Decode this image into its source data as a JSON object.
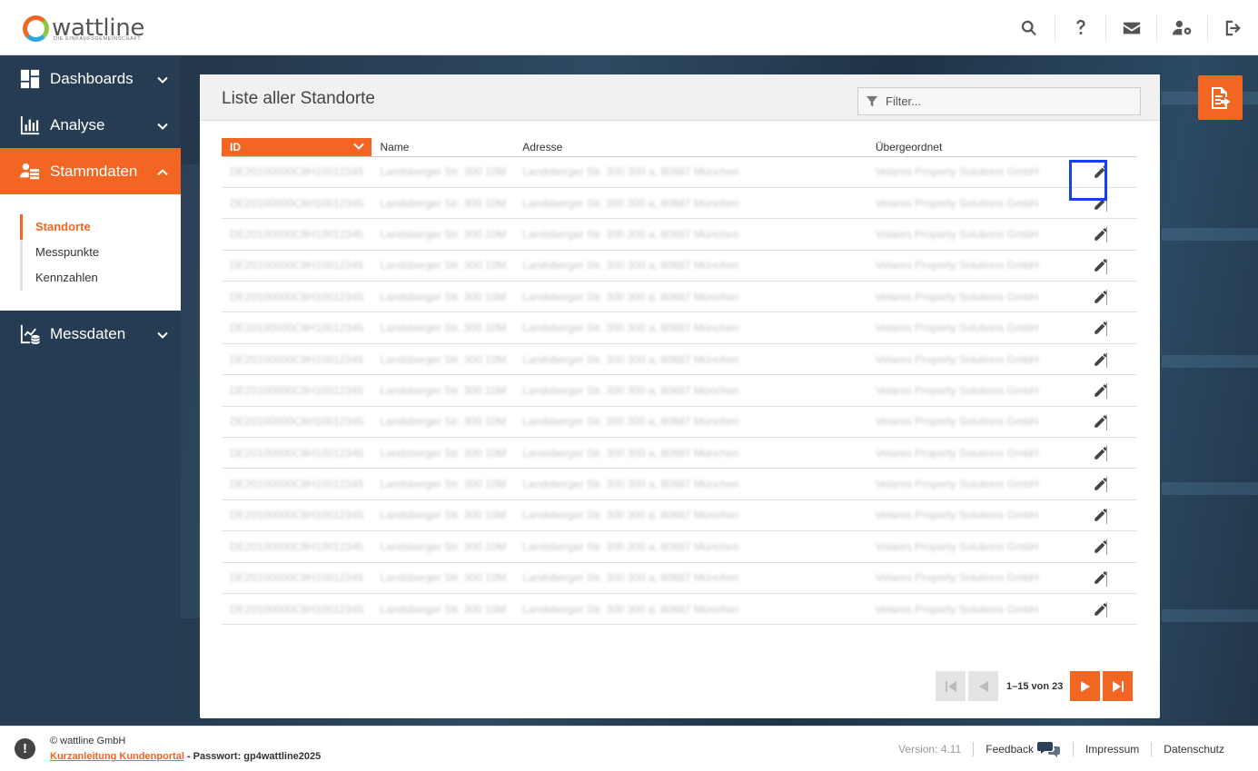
{
  "brand": {
    "name": "wattline",
    "tagline": "DIE EINKAUFSGEMEINSCHAFT"
  },
  "header": {
    "icons": [
      "search-icon",
      "help-icon",
      "mail-icon",
      "user-settings-icon",
      "logout-icon"
    ]
  },
  "sidebar": {
    "items": [
      {
        "label": "Dashboards",
        "icon": "dashboard-icon",
        "active": false
      },
      {
        "label": "Analyse",
        "icon": "bar-chart-icon",
        "active": false
      },
      {
        "label": "Stammdaten",
        "icon": "master-data-icon",
        "active": true
      },
      {
        "label": "Messdaten",
        "icon": "measurement-icon",
        "active": false
      }
    ],
    "subitems": [
      {
        "label": "Standorte",
        "active": true
      },
      {
        "label": "Messpunkte",
        "active": false
      },
      {
        "label": "Kennzahlen",
        "active": false
      }
    ]
  },
  "panel": {
    "title": "Liste aller Standorte",
    "filter_placeholder": "Filter...",
    "columns": [
      "ID",
      "Name",
      "Adresse",
      "Übergeordnet"
    ],
    "rows": [
      [
        "DE20100000C8H10012345",
        "Landsberger Str. 300 10M",
        "Landsberger Str. 300 300 a, 80687 München",
        "Velares Property Solutions GmbH"
      ],
      [
        "DE20100000C8H10012345",
        "Landsberger Str. 300 10M",
        "Landsberger Str. 300 300 a, 80687 München",
        "Velares Property Solutions GmbH"
      ],
      [
        "DE20100000C8H10012345",
        "Landsberger Str. 300 10M",
        "Landsberger Str. 300 300 a, 80687 München",
        "Velares Property Solutions GmbH"
      ],
      [
        "DE20100000C8H10012345",
        "Landsberger Str. 300 10M",
        "Landsberger Str. 300 300 a, 80687 München",
        "Velares Property Solutions GmbH"
      ],
      [
        "DE20100000C8H10012345",
        "Landsberger Str. 300 10M",
        "Landsberger Str. 300 300 a, 80687 München",
        "Velares Property Solutions GmbH"
      ],
      [
        "DE20100000C8H10012345",
        "Landsberger Str. 300 10M",
        "Landsberger Str. 300 300 a, 80687 München",
        "Velares Property Solutions GmbH"
      ],
      [
        "DE20100000C8H10012345",
        "Landsberger Str. 300 10M",
        "Landsberger Str. 300 300 a, 80687 München",
        "Velares Property Solutions GmbH"
      ],
      [
        "DE20100000C8H10012345",
        "Landsberger Str. 300 10M",
        "Landsberger Str. 300 300 a, 80687 München",
        "Velares Property Solutions GmbH"
      ],
      [
        "DE20100000C8H10012345",
        "Landsberger Str. 300 10M",
        "Landsberger Str. 300 300 a, 80687 München",
        "Velares Property Solutions GmbH"
      ],
      [
        "DE20100000C8H10012345",
        "Landsberger Str. 300 10M",
        "Landsberger Str. 300 300 a, 80687 München",
        "Velares Property Solutions GmbH"
      ],
      [
        "DE20100000C8H10012345",
        "Landsberger Str. 300 10M",
        "Landsberger Str. 300 300 a, 80687 München",
        "Velares Property Solutions GmbH"
      ],
      [
        "DE20100000C8H10012345",
        "Landsberger Str. 300 10M",
        "Landsberger Str. 300 300 a, 80687 München",
        "Velares Property Solutions GmbH"
      ],
      [
        "DE20100000C8H10012345",
        "Landsberger Str. 300 10M",
        "Landsberger Str. 300 300 a, 80687 München",
        "Velares Property Solutions GmbH"
      ],
      [
        "DE20100000C8H10012345",
        "Landsberger Str. 300 10M",
        "Landsberger Str. 300 300 a, 80687 München",
        "Velares Property Solutions GmbH"
      ],
      [
        "DE20100000C8H10012345",
        "Landsberger Str. 300 10M",
        "Landsberger Str. 300 300 a, 80687 München",
        "Velares Property Solutions GmbH"
      ]
    ],
    "row_action_icon": "pencil-icon",
    "pagination": "1–15 von 23"
  },
  "footer": {
    "copyright": "© wattline GmbH",
    "guide_link": "Kurzanleitung Kundenportal",
    "password_text": " - Passwort: gp4wattline2025",
    "version": "Version: 4.11",
    "feedback": "Feedback",
    "impressum": "Impressum",
    "datenschutz": "Datenschutz"
  },
  "colors": {
    "accent": "#f26522",
    "sidebar": "#263c52",
    "highlight": "#1740f0"
  }
}
